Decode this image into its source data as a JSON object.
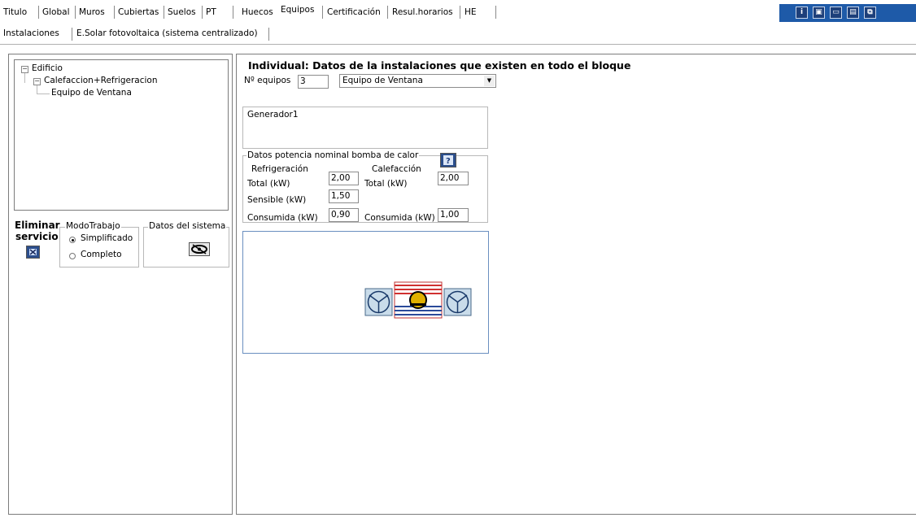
{
  "top_tabs": [
    {
      "label": "Titulo",
      "active": false
    },
    {
      "label": "Global",
      "active": false
    },
    {
      "label": "Muros",
      "active": false
    },
    {
      "label": "Cubiertas",
      "active": false
    },
    {
      "label": "Suelos",
      "active": false
    },
    {
      "label": "PT",
      "active": false
    },
    {
      "label": "Huecos",
      "active": false
    },
    {
      "label": "Equipos",
      "active": true
    },
    {
      "label": "Certificación",
      "active": false
    },
    {
      "label": "Resul.horarios",
      "active": false
    },
    {
      "label": "HE",
      "active": false
    }
  ],
  "toolbar_icons": [
    "info-icon",
    "document-icon",
    "window-icon",
    "save-icon",
    "copy-icon"
  ],
  "sub_tabs": [
    {
      "label": "Instalaciones",
      "active": true
    },
    {
      "label": "E.Solar fotovoltaica (sistema centralizado)",
      "active": false
    }
  ],
  "tree": {
    "root": "Edificio",
    "child": "Calefaccion+Refrigeracion",
    "leaf": "Equipo de Ventana"
  },
  "left_controls": {
    "delete_label_line1": "Eliminar",
    "delete_label_line2": "servicio",
    "mode_group_label": "ModoTrabajo",
    "mode_options": [
      "Simplificado",
      "Completo"
    ],
    "mode_selected": "Simplificado",
    "system_group_label": "Datos del sistema"
  },
  "main": {
    "title": "Individual: Datos de la instalaciones que existen en todo el bloque",
    "num_equipos_label": "Nº equipos",
    "num_equipos_value": "3",
    "equipment_type": "Equipo de Ventana",
    "generator_group_label": "Generador1",
    "power_group_label": "Datos potencia nominal bomba de calor",
    "refrigeracion_label": "Refrigeración",
    "calefaccion_label": "Calefacción",
    "total_label": "Total (kW)",
    "sensible_label": "Sensible (kW)",
    "consumida_label": "Consumida (kW)",
    "ref_total": "2,00",
    "ref_sensible": "1,50",
    "ref_consumida": "0,90",
    "cal_total": "2,00",
    "cal_consumida": "1,00"
  },
  "colors": {
    "toolbar_blue": "#1e5aa8",
    "diagram_border": "#6a8fc0",
    "diagram_fan_bg": "#c9dcea"
  }
}
